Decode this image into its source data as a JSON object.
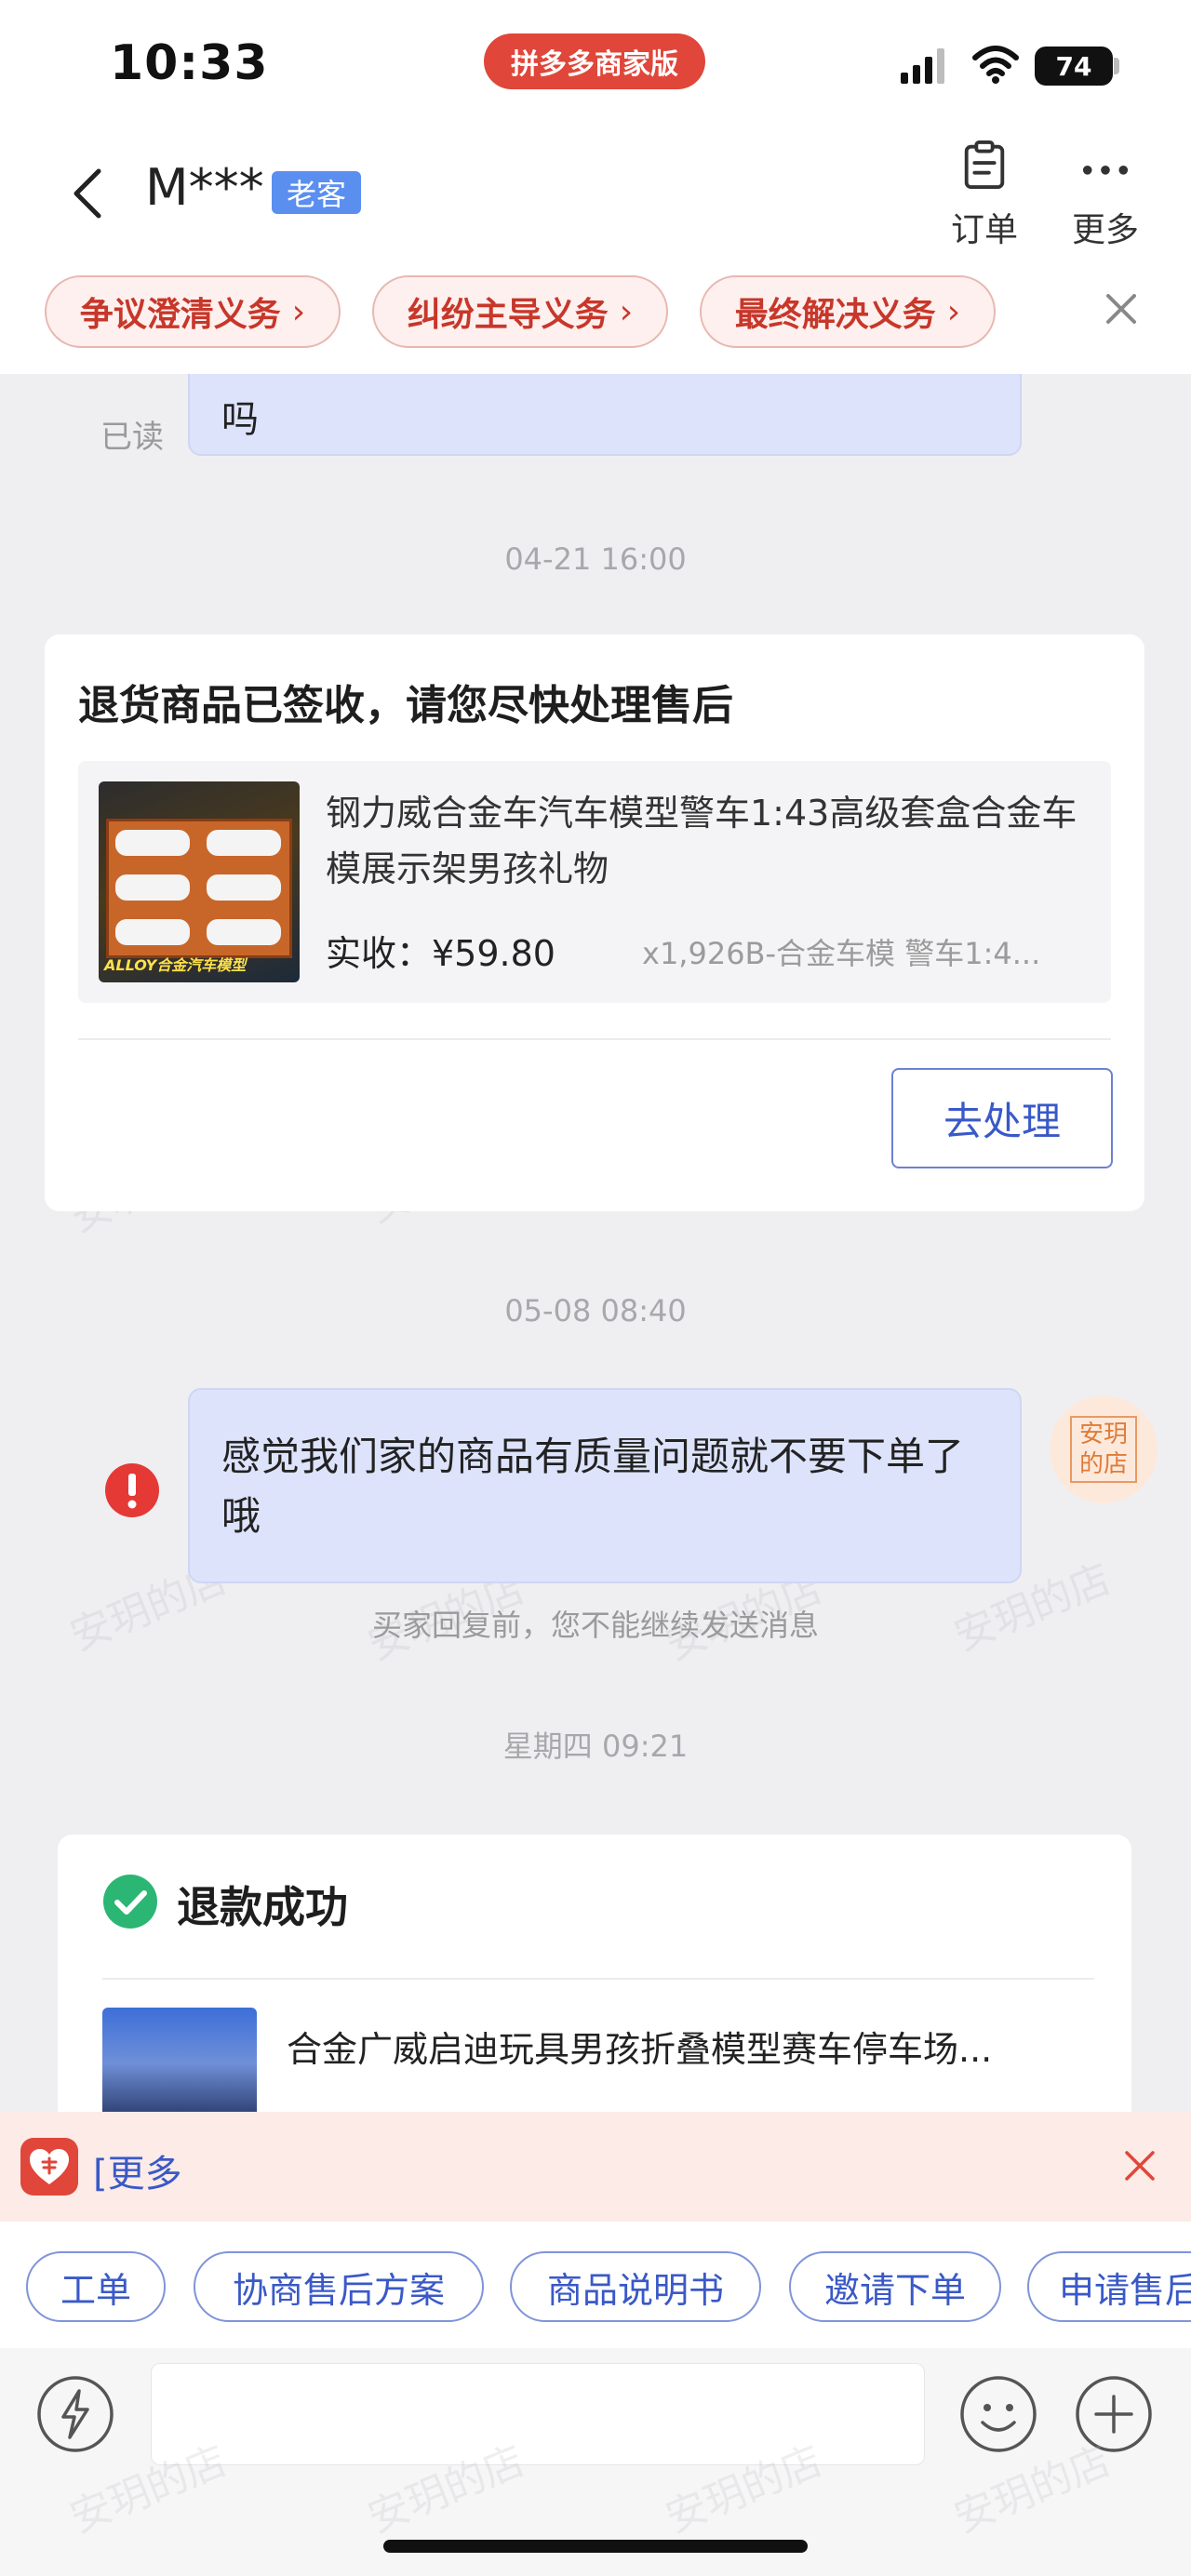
{
  "status_bar": {
    "time": "10:33",
    "app_name": "拼多多商家版",
    "battery": "74"
  },
  "nav": {
    "title": "M***",
    "tag": "老客",
    "order_label": "订单",
    "more_label": "更多"
  },
  "obligations": {
    "chips": [
      {
        "label": "争议澄清义务"
      },
      {
        "label": "纠纷主导义务"
      },
      {
        "label": "最终解决义务"
      }
    ]
  },
  "messages": {
    "partial_text": "吗",
    "partial_read": "已读",
    "ts1": "04-21 16:00",
    "return_card": {
      "title": "退货商品已签收，请您尽快处理售后",
      "product_name": "钢力威合金车汽车模型警车1:43高级套盒合金车模展示架男孩礼物",
      "paid_label": "实收：¥59.80",
      "sku": "x1,926B-合金车模  警车1:4...",
      "thumb_text": "ALLOY合金汽车模型",
      "action": "去处理"
    },
    "ts2": "05-08 08:40",
    "sent_text": "感觉我们家的商品有质量问题就不要下单了哦",
    "avatar_text": "安玥的店",
    "notice": "买家回复前，您不能继续发送消息",
    "ts3": "星期四 09:21",
    "refund_card": {
      "status": "退款成功",
      "product_name": "合金广威启迪玩具男孩折叠模型赛车停车场..."
    }
  },
  "watermark_text": "安玥的店",
  "banner": {
    "text": "[更多"
  },
  "quick_actions": [
    {
      "label": "工单"
    },
    {
      "label": "协商售后方案"
    },
    {
      "label": "商品说明书"
    },
    {
      "label": "邀请下单"
    },
    {
      "label": "申请售后"
    }
  ],
  "colors": {
    "accent_red": "#e0463a",
    "accent_blue": "#3a59c7",
    "bubble": "#dde3fb",
    "success_green": "#2bb673"
  }
}
